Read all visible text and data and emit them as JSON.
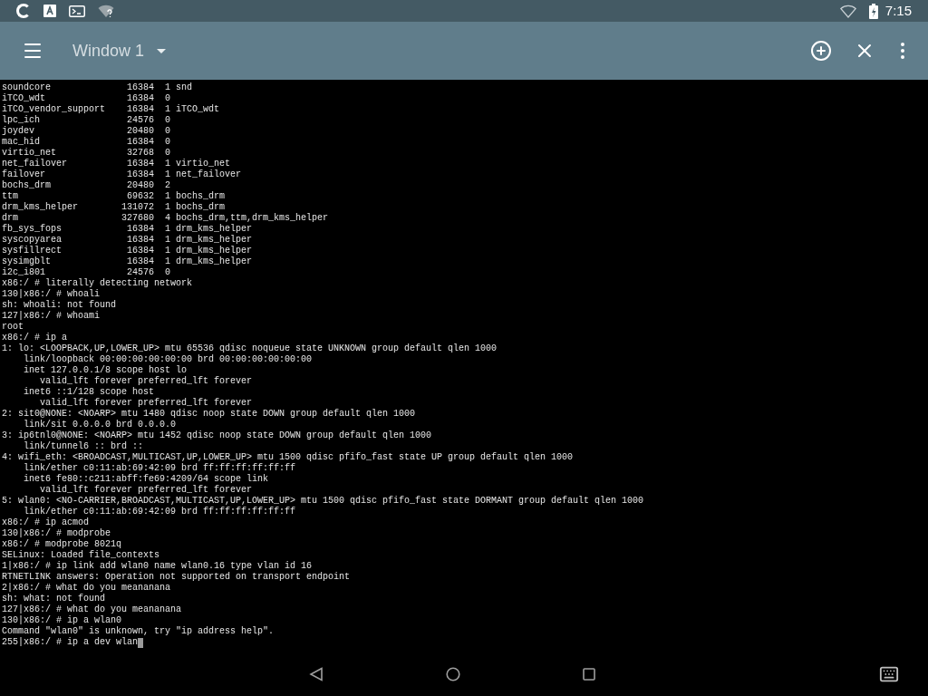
{
  "status_bar": {
    "time": "7:15"
  },
  "toolbar": {
    "title": "Window 1"
  },
  "terminal": {
    "modules": [
      {
        "name": "soundcore",
        "size": "16384",
        "used": "1",
        "by": "snd"
      },
      {
        "name": "iTCO_wdt",
        "size": "16384",
        "used": "0"
      },
      {
        "name": "iTCO_vendor_support",
        "size": "16384",
        "used": "1",
        "by": "iTCO_wdt"
      },
      {
        "name": "lpc_ich",
        "size": "24576",
        "used": "0"
      },
      {
        "name": "joydev",
        "size": "20480",
        "used": "0"
      },
      {
        "name": "mac_hid",
        "size": "16384",
        "used": "0"
      },
      {
        "name": "virtio_net",
        "size": "32768",
        "used": "0"
      },
      {
        "name": "net_failover",
        "size": "16384",
        "used": "1",
        "by": "virtio_net"
      },
      {
        "name": "failover",
        "size": "16384",
        "used": "1",
        "by": "net_failover"
      },
      {
        "name": "bochs_drm",
        "size": "20480",
        "used": "2"
      },
      {
        "name": "ttm",
        "size": "69632",
        "used": "1",
        "by": "bochs_drm"
      },
      {
        "name": "drm_kms_helper",
        "size": "131072",
        "used": "1",
        "by": "bochs_drm"
      },
      {
        "name": "drm",
        "size": "327680",
        "used": "4",
        "by": "bochs_drm,ttm,drm_kms_helper"
      },
      {
        "name": "fb_sys_fops",
        "size": "16384",
        "used": "1",
        "by": "drm_kms_helper"
      },
      {
        "name": "syscopyarea",
        "size": "16384",
        "used": "1",
        "by": "drm_kms_helper"
      },
      {
        "name": "sysfillrect",
        "size": "16384",
        "used": "1",
        "by": "drm_kms_helper"
      },
      {
        "name": "sysimgblt",
        "size": "16384",
        "used": "1",
        "by": "drm_kms_helper"
      },
      {
        "name": "i2c_i801",
        "size": "24576",
        "used": "0"
      }
    ],
    "lines": [
      "x86:/ # literally detecting network",
      "130|x86:/ # whoali",
      "sh: whoali: not found",
      "127|x86:/ # whoami",
      "root",
      "x86:/ # ip a",
      "1: lo: <LOOPBACK,UP,LOWER_UP> mtu 65536 qdisc noqueue state UNKNOWN group default qlen 1000",
      "    link/loopback 00:00:00:00:00:00 brd 00:00:00:00:00:00",
      "    inet 127.0.0.1/8 scope host lo",
      "       valid_lft forever preferred_lft forever",
      "    inet6 ::1/128 scope host",
      "       valid_lft forever preferred_lft forever",
      "2: sit0@NONE: <NOARP> mtu 1480 qdisc noop state DOWN group default qlen 1000",
      "    link/sit 0.0.0.0 brd 0.0.0.0",
      "3: ip6tnl0@NONE: <NOARP> mtu 1452 qdisc noop state DOWN group default qlen 1000",
      "    link/tunnel6 :: brd ::",
      "4: wifi_eth: <BROADCAST,MULTICAST,UP,LOWER_UP> mtu 1500 qdisc pfifo_fast state UP group default qlen 1000",
      "    link/ether c0:11:ab:69:42:09 brd ff:ff:ff:ff:ff:ff",
      "    inet6 fe80::c211:abff:fe69:4209/64 scope link",
      "       valid_lft forever preferred_lft forever",
      "5: wlan0: <NO-CARRIER,BROADCAST,MULTICAST,UP,LOWER_UP> mtu 1500 qdisc pfifo_fast state DORMANT group default qlen 1000",
      "    link/ether c0:11:ab:69:42:09 brd ff:ff:ff:ff:ff:ff",
      "x86:/ # ip acmod",
      "130|x86:/ # modprobe",
      "x86:/ # modprobe 8021q",
      "SELinux: Loaded file_contexts",
      "1|x86:/ # ip link add wlan0 name wlan0.16 type vlan id 16",
      "RTNETLINK answers: Operation not supported on transport endpoint",
      "2|x86:/ # what do you meananana",
      "sh: what: not found",
      "127|x86:/ # what do you meananana",
      "130|x86:/ # ip a wlan0",
      "Command \"wlan0\" is unknown, try \"ip address help\".",
      "255|x86:/ # ip a dev wlan"
    ]
  }
}
